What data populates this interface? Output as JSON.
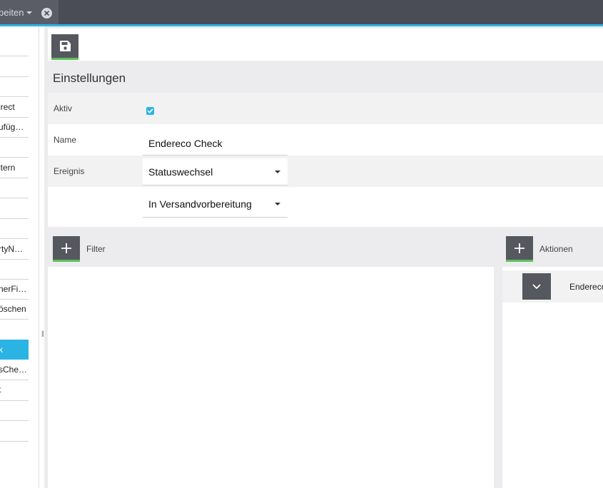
{
  "tab": {
    "label": "beiten",
    "close_symbol": "×"
  },
  "sidebar": {
    "items": [
      {
        "label": "irect"
      },
      {
        "label": "ufüg…"
      },
      {
        "label": "ltern"
      },
      {
        "label": "l"
      },
      {
        "label": "rtyN…"
      },
      {
        "label": "nerFi…"
      },
      {
        "label": "öschen"
      },
      {
        "label": "k",
        "active": true
      },
      {
        "label": "sChe…"
      },
      {
        "label": "t"
      }
    ]
  },
  "toolbar": {
    "save_icon": "floppy-disk-icon"
  },
  "section": {
    "title": "Einstellungen"
  },
  "form": {
    "aktiv_label": "Aktiv",
    "aktiv_checked": true,
    "name_label": "Name",
    "name_value": "Endereco Check",
    "ereignis_label": "Ereignis",
    "ereignis_value": "Statuswechsel",
    "status_value": "In Versandvorbereitung"
  },
  "filter": {
    "label": "Filter"
  },
  "actions": {
    "label": "Aktionen",
    "items": [
      {
        "label": "Endereco"
      }
    ]
  },
  "colors": {
    "accent": "#2bb4e3",
    "button_dark": "#55585f",
    "button_underline": "#5ec15b",
    "topbar": "#4a4d55"
  }
}
